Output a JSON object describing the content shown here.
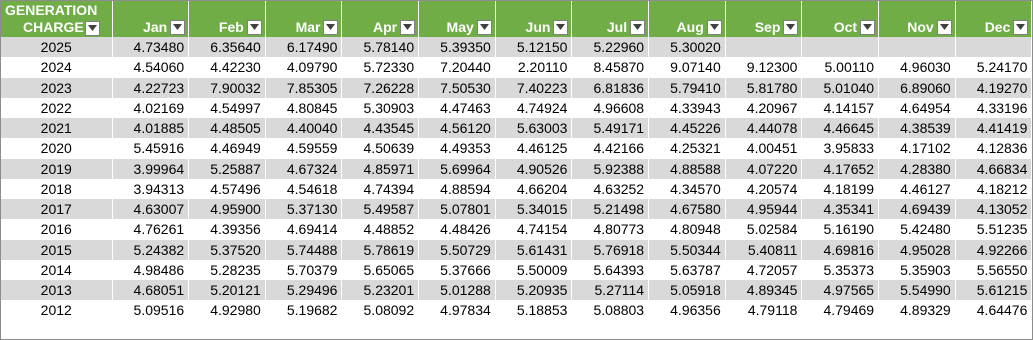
{
  "header": {
    "year_label_line1": "GENERATION",
    "year_label_line2": "CHARGE",
    "months": [
      "Jan",
      "Feb",
      "Mar",
      "Apr",
      "May",
      "Jun",
      "Jul",
      "Aug",
      "Sep",
      "Oct",
      "Nov",
      "Dec"
    ]
  },
  "rows": [
    {
      "year": "2025",
      "values": [
        "4.73480",
        "6.35640",
        "6.17490",
        "5.78140",
        "5.39350",
        "5.12150",
        "5.22960",
        "5.30020",
        "",
        "",
        "",
        ""
      ]
    },
    {
      "year": "2024",
      "values": [
        "4.54060",
        "4.42230",
        "4.09790",
        "5.72330",
        "7.20440",
        "2.20110",
        "8.45870",
        "9.07140",
        "9.12300",
        "5.00110",
        "4.96030",
        "5.24170"
      ]
    },
    {
      "year": "2023",
      "values": [
        "4.22723",
        "7.90032",
        "7.85305",
        "7.26228",
        "7.50530",
        "7.40223",
        "6.81836",
        "5.79410",
        "5.81780",
        "5.01040",
        "6.89060",
        "4.19270"
      ]
    },
    {
      "year": "2022",
      "values": [
        "4.02169",
        "4.54997",
        "4.80845",
        "5.30903",
        "4.47463",
        "4.74924",
        "4.96608",
        "4.33943",
        "4.20967",
        "4.14157",
        "4.64954",
        "4.33196"
      ]
    },
    {
      "year": "2021",
      "values": [
        "4.01885",
        "4.48505",
        "4.40040",
        "4.43545",
        "4.56120",
        "5.63003",
        "5.49171",
        "4.45226",
        "4.44078",
        "4.46645",
        "4.38539",
        "4.41419"
      ]
    },
    {
      "year": "2020",
      "values": [
        "5.45916",
        "4.46949",
        "4.59559",
        "4.50639",
        "4.49353",
        "4.46125",
        "4.42166",
        "4.25321",
        "4.00451",
        "3.95833",
        "4.17102",
        "4.12836"
      ]
    },
    {
      "year": "2019",
      "values": [
        "3.99964",
        "5.25887",
        "4.67324",
        "4.85971",
        "5.69964",
        "4.90526",
        "5.92388",
        "4.88588",
        "4.07220",
        "4.17652",
        "4.28380",
        "4.66834"
      ]
    },
    {
      "year": "2018",
      "values": [
        "3.94313",
        "4.57496",
        "4.54618",
        "4.74394",
        "4.88594",
        "4.66204",
        "4.63252",
        "4.34570",
        "4.20574",
        "4.18199",
        "4.46127",
        "4.18212"
      ]
    },
    {
      "year": "2017",
      "values": [
        "4.63007",
        "4.95900",
        "5.37130",
        "5.49587",
        "5.07801",
        "5.34015",
        "5.21498",
        "4.67580",
        "4.95944",
        "4.35341",
        "4.69439",
        "4.13052"
      ]
    },
    {
      "year": "2016",
      "values": [
        "4.76261",
        "4.39356",
        "4.69414",
        "4.48852",
        "4.48426",
        "4.74154",
        "4.80773",
        "4.80948",
        "5.02584",
        "5.16190",
        "5.42480",
        "5.51235"
      ]
    },
    {
      "year": "2015",
      "values": [
        "5.24382",
        "5.37520",
        "5.74488",
        "5.78619",
        "5.50729",
        "5.61431",
        "5.76918",
        "5.50344",
        "5.40811",
        "4.69816",
        "4.95028",
        "4.92266"
      ]
    },
    {
      "year": "2014",
      "values": [
        "4.98486",
        "5.28235",
        "5.70379",
        "5.65065",
        "5.37666",
        "5.50009",
        "5.64393",
        "5.63787",
        "4.72057",
        "5.35373",
        "5.35903",
        "5.56550"
      ]
    },
    {
      "year": "2013",
      "values": [
        "4.68051",
        "5.20121",
        "5.29496",
        "5.23201",
        "5.01288",
        "5.20935",
        "5.27114",
        "5.05918",
        "4.89345",
        "4.97565",
        "5.54990",
        "5.61215"
      ]
    },
    {
      "year": "2012",
      "values": [
        "5.09516",
        "4.92980",
        "5.19682",
        "5.08092",
        "4.97834",
        "5.18853",
        "5.08803",
        "4.96356",
        "4.79118",
        "4.79469",
        "4.89329",
        "4.64476"
      ]
    }
  ]
}
